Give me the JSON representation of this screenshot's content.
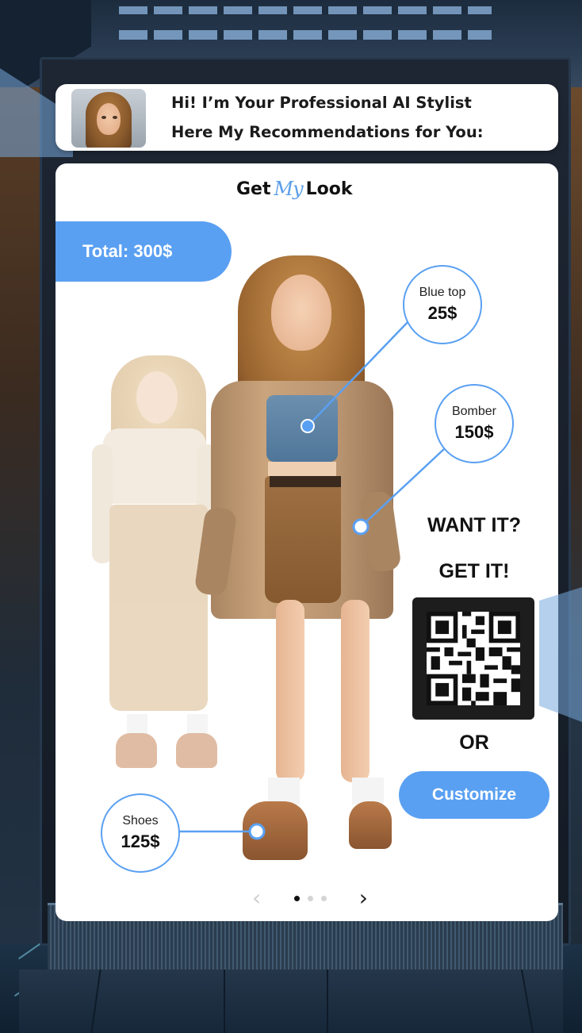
{
  "stylist": {
    "greeting_line1": "Hi! I’m Your Professional AI Stylist",
    "greeting_line2": "Here My Recommendations for You:"
  },
  "brand": {
    "logo_left": "Get",
    "logo_script": "My",
    "logo_right": "Look"
  },
  "outfit": {
    "total_label": "Total: 300$",
    "items": [
      {
        "name": "Blue top",
        "price": "25$"
      },
      {
        "name": "Bomber",
        "price": "150$"
      },
      {
        "name": "Shoes",
        "price": "125$"
      }
    ]
  },
  "cta": {
    "line1": "WANT IT?",
    "line2": "GET IT!",
    "or_label": "OR",
    "customize_label": "Customize"
  },
  "pager": {
    "prev_glyph": "‹",
    "next_glyph": "›",
    "page_count": 3,
    "active_page": 1
  },
  "colors": {
    "accent": "#5aa0f2",
    "card": "#ffffff",
    "text": "#111111"
  },
  "icons": {
    "prev": "chevron-left-icon",
    "next": "chevron-right-icon",
    "qr": "qr-code-icon"
  }
}
